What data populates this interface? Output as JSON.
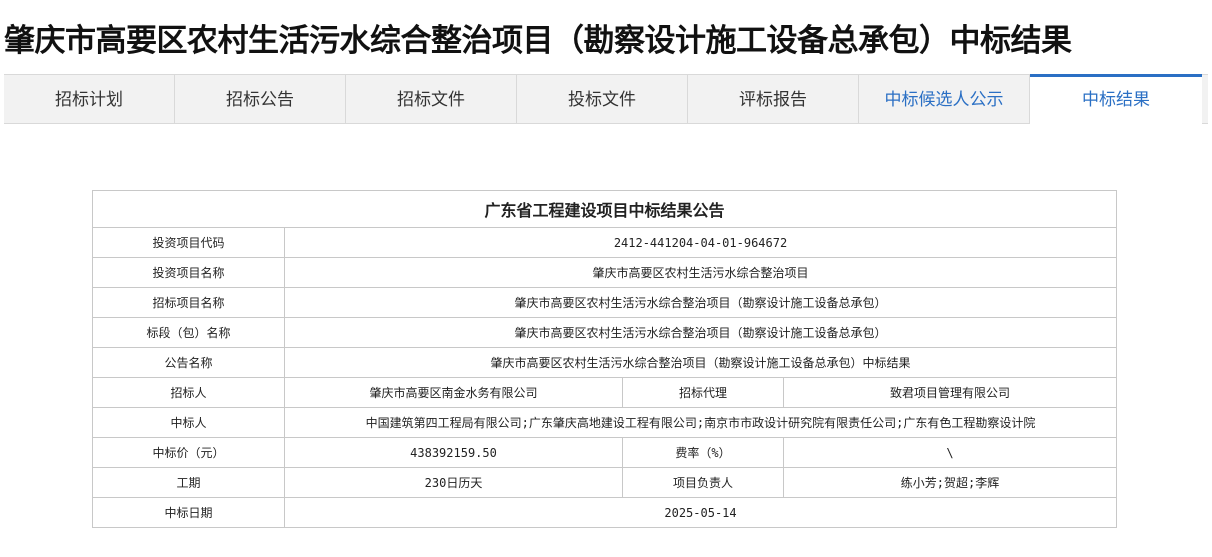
{
  "page": {
    "title": "肇庆市高要区农村生活污水综合整治项目（勘察设计施工设备总承包）中标结果"
  },
  "tabs": [
    {
      "label": "招标计划"
    },
    {
      "label": "招标公告"
    },
    {
      "label": "招标文件"
    },
    {
      "label": "投标文件"
    },
    {
      "label": "评标报告"
    },
    {
      "label": "中标候选人公示"
    },
    {
      "label": "中标结果"
    }
  ],
  "colors": {
    "accent": "#2a6fc4",
    "border": "#c8c8c8",
    "tab_bg": "#f2f2f2"
  },
  "announcement": {
    "caption": "广东省工程建设项目中标结果公告",
    "investment_code_label": "投资项目代码",
    "investment_code": "2412-441204-04-01-964672",
    "investment_name_label": "投资项目名称",
    "investment_name": "肇庆市高要区农村生活污水综合整治项目",
    "tender_project_label": "招标项目名称",
    "tender_project": "肇庆市高要区农村生活污水综合整治项目（勘察设计施工设备总承包）",
    "section_label": "标段（包）名称",
    "section_name": "肇庆市高要区农村生活污水综合整治项目（勘察设计施工设备总承包）",
    "notice_name_label": "公告名称",
    "notice_name": "肇庆市高要区农村生活污水综合整治项目（勘察设计施工设备总承包）中标结果",
    "tenderer_label": "招标人",
    "tenderer": "肇庆市高要区南金水务有限公司",
    "agent_label": "招标代理",
    "agent": "致君项目管理有限公司",
    "winner_label": "中标人",
    "winner": "中国建筑第四工程局有限公司;广东肇庆高地建设工程有限公司;南京市市政设计研究院有限责任公司;广东有色工程勘察设计院",
    "price_label": "中标价（元）",
    "price": "438392159.50",
    "rate_label": "费率（%）",
    "rate": "\\",
    "duration_label": "工期",
    "duration": "230日历天",
    "manager_label": "项目负责人",
    "manager": "练小芳;贺超;李辉",
    "date_label": "中标日期",
    "date": "2025-05-14"
  }
}
